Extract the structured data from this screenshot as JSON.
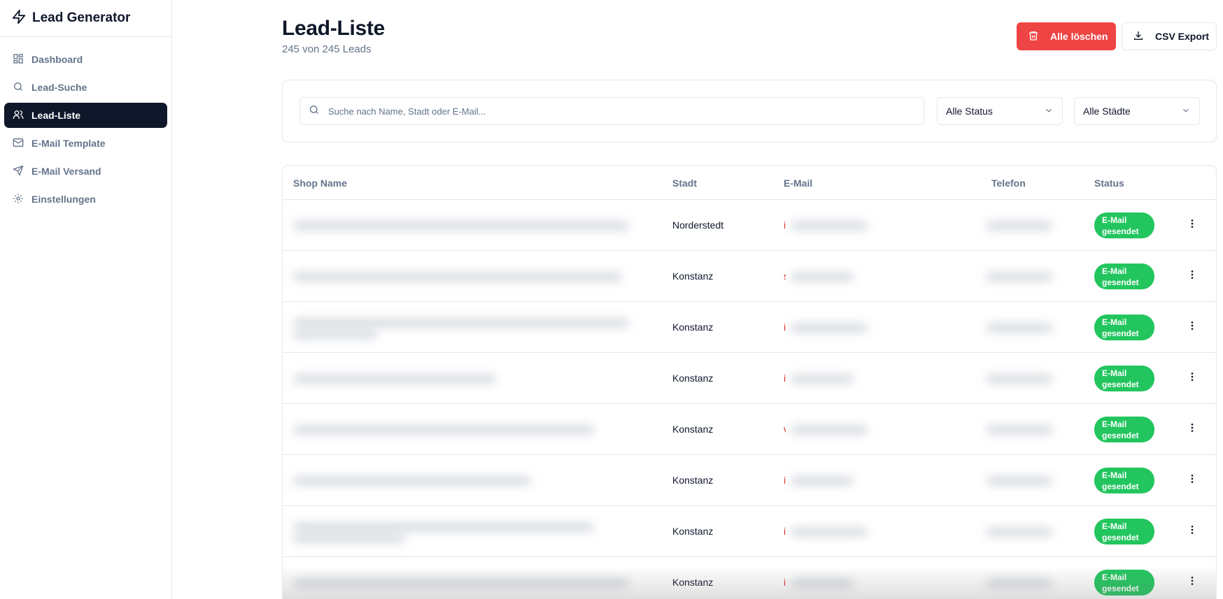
{
  "app": {
    "name": "Lead Generator",
    "logo_icon": "zap-icon"
  },
  "sidebar": {
    "items": [
      {
        "label": "Dashboard",
        "icon": "grid-icon",
        "active": false
      },
      {
        "label": "Lead-Suche",
        "icon": "search-icon",
        "active": false
      },
      {
        "label": "Lead-Liste",
        "icon": "users-icon",
        "active": true
      },
      {
        "label": "E-Mail Template",
        "icon": "mail-icon",
        "active": false
      },
      {
        "label": "E-Mail Versand",
        "icon": "send-icon",
        "active": false
      },
      {
        "label": "Einstellungen",
        "icon": "gear-icon",
        "active": false
      }
    ]
  },
  "header": {
    "title": "Lead-Liste",
    "subtitle": "245 von 245 Leads",
    "delete_all_label": "Alle löschen",
    "export_label": "CSV Export"
  },
  "filters": {
    "search_placeholder": "Suche nach Name, Stadt oder E-Mail...",
    "status_value": "Alle Status",
    "city_value": "Alle Städte"
  },
  "table": {
    "columns": [
      "Shop Name",
      "Stadt",
      "E-Mail",
      "Telefon",
      "Status"
    ],
    "rows": [
      {
        "city": "Norderstedt",
        "email_visible": "i",
        "status_line1": "E-Mail",
        "status_line2": "gesendet"
      },
      {
        "city": "Konstanz",
        "email_visible": "s",
        "status_line1": "E-Mail",
        "status_line2": "gesendet"
      },
      {
        "city": "Konstanz",
        "email_visible": "i",
        "status_line1": "E-Mail",
        "status_line2": "gesendet"
      },
      {
        "city": "Konstanz",
        "email_visible": "i",
        "status_line1": "E-Mail",
        "status_line2": "gesendet"
      },
      {
        "city": "Konstanz",
        "email_visible": "v",
        "status_line1": "E-Mail",
        "status_line2": "gesendet"
      },
      {
        "city": "Konstanz",
        "email_visible": "i",
        "status_line1": "E-Mail",
        "status_line2": "gesendet"
      },
      {
        "city": "Konstanz",
        "email_visible": "i",
        "status_line1": "E-Mail",
        "status_line2": "gesendet"
      },
      {
        "city": "Konstanz",
        "email_visible": "i",
        "status_line1": "E-Mail",
        "status_line2": "gesendet"
      }
    ]
  },
  "colors": {
    "primary_dark": "#0f172a",
    "danger": "#ef4444",
    "success": "#22c55e",
    "muted_text": "#64748b",
    "border": "#e5e7eb"
  }
}
